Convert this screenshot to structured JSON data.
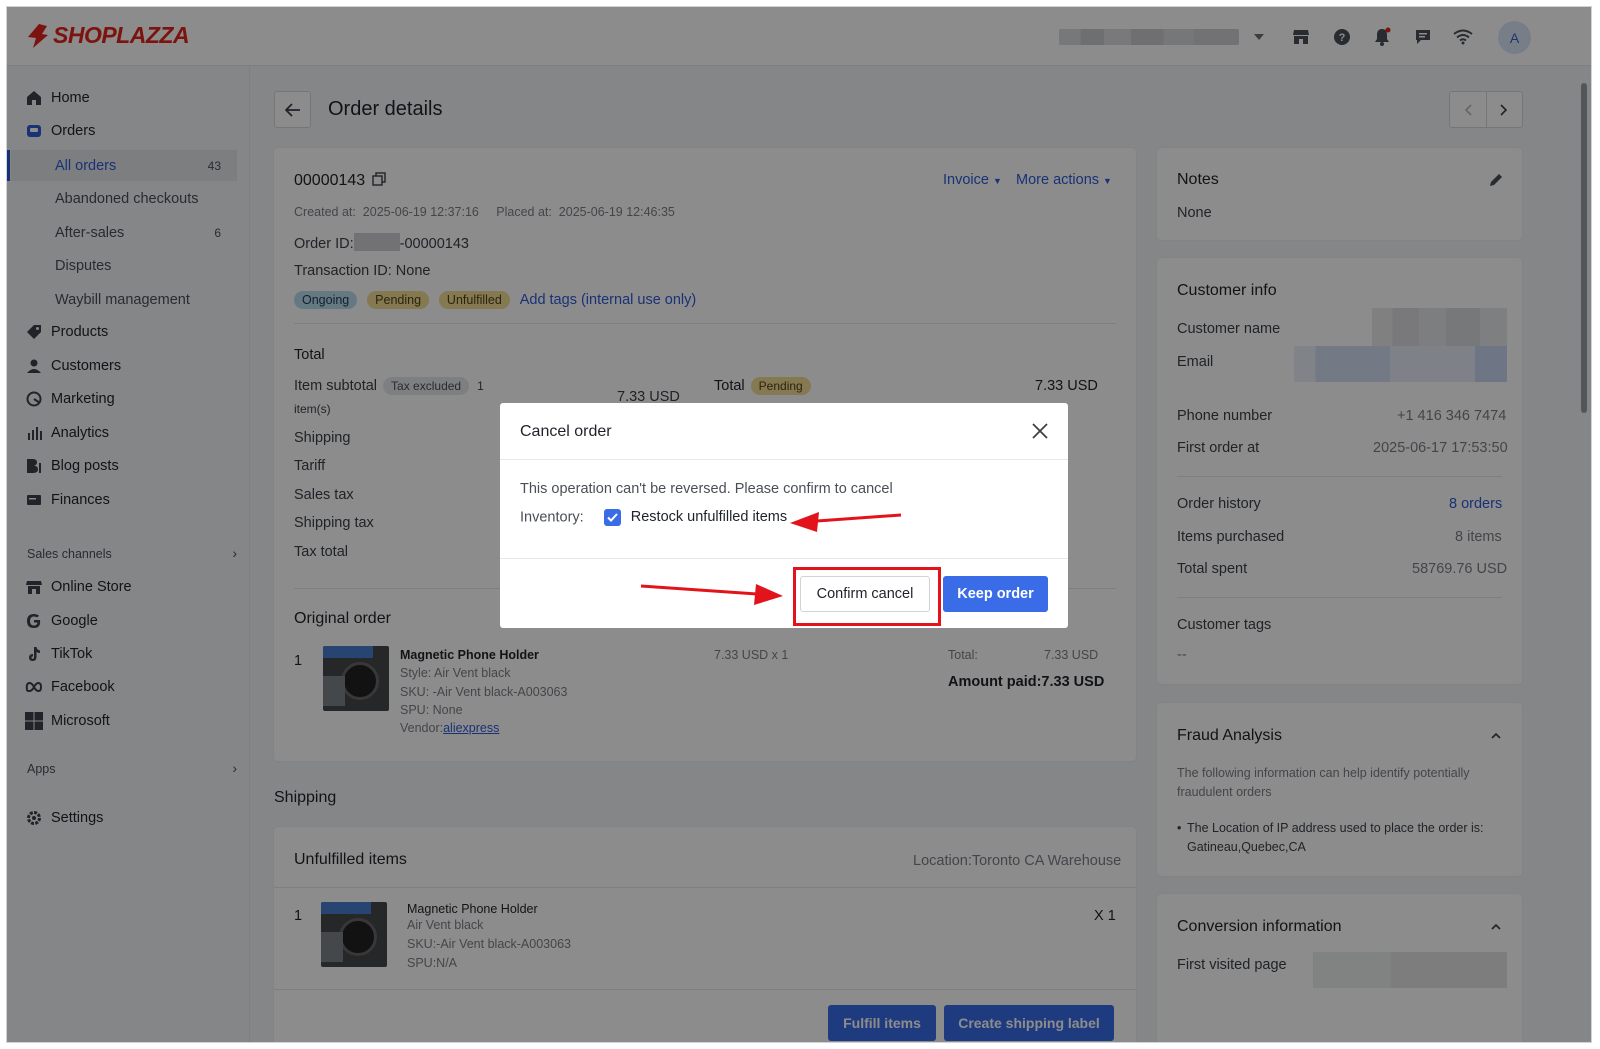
{
  "brand": {
    "name": "SHOPLAZZA",
    "color": "#e2231a"
  },
  "topbar": {
    "avatar_letter": "A",
    "icons": [
      "store-icon",
      "help-icon",
      "bell-icon",
      "chat-icon",
      "wifi-icon"
    ]
  },
  "sidebar": {
    "items": [
      {
        "label": "Home",
        "icon": "home-icon"
      },
      {
        "label": "Orders",
        "icon": "orders-icon"
      },
      {
        "label": "Products",
        "icon": "tag-icon"
      },
      {
        "label": "Customers",
        "icon": "person-icon"
      },
      {
        "label": "Marketing",
        "icon": "marketing-icon"
      },
      {
        "label": "Analytics",
        "icon": "analytics-icon"
      },
      {
        "label": "Blog posts",
        "icon": "blog-icon"
      },
      {
        "label": "Finances",
        "icon": "finances-icon"
      }
    ],
    "orders_sub": [
      {
        "label": "All orders",
        "count": "43"
      },
      {
        "label": "Abandoned checkouts",
        "count": ""
      },
      {
        "label": "After-sales",
        "count": "6"
      },
      {
        "label": "Disputes",
        "count": ""
      },
      {
        "label": "Waybill management",
        "count": ""
      }
    ],
    "sales_channels_label": "Sales channels",
    "channels": [
      {
        "label": "Online Store",
        "icon": "store-icon"
      },
      {
        "label": "Google",
        "icon": "google-icon"
      },
      {
        "label": "TikTok",
        "icon": "tiktok-icon"
      },
      {
        "label": "Facebook",
        "icon": "meta-icon"
      },
      {
        "label": "Microsoft",
        "icon": "microsoft-icon"
      }
    ],
    "apps_label": "Apps",
    "settings_label": "Settings"
  },
  "page": {
    "title": "Order details"
  },
  "order": {
    "number": "00000143",
    "invoice_label": "Invoice",
    "more_actions_label": "More actions",
    "created_label": "Created at:",
    "created_value": "2025-06-19 12:37:16",
    "placed_label": "Placed at:",
    "placed_value": "2025-06-19 12:46:35",
    "order_id_label": "Order ID:",
    "order_id_suffix": "-00000143",
    "transaction_id": "Transaction ID: None",
    "tags": [
      "Ongoing",
      "Pending",
      "Unfulfilled"
    ],
    "add_tags": "Add tags (internal use only)"
  },
  "totals": {
    "heading": "Total",
    "item_subtotal_label": "Item subtotal",
    "tax_excluded": "Tax excluded",
    "item_count": "1",
    "items_suffix": "item(s)",
    "item_subtotal_value": "7.33 USD",
    "rows": [
      "Shipping",
      "Tariff",
      "Sales tax",
      "Shipping tax",
      "Tax total"
    ],
    "total_label": "Total",
    "total_status": "Pending",
    "total_value": "7.33 USD"
  },
  "original_order": {
    "heading": "Original order",
    "index": "1",
    "product_name": "Magnetic Phone Holder",
    "style": "Style: Air Vent black",
    "sku": "SKU: -Air Vent black-A003063",
    "spu": "SPU: None",
    "vendor_label": "Vendor:",
    "vendor": "aliexpress",
    "price_qty": "7.33 USD x 1",
    "total_label": "Total:",
    "total_value": "7.33 USD",
    "amount_paid": "Amount paid:7.33 USD"
  },
  "shipping": {
    "heading": "Shipping",
    "unfulfilled_heading": "Unfulfilled items",
    "location": "Location:Toronto CA Warehouse",
    "index": "1",
    "product_name": "Magnetic Phone Holder",
    "variant": "Air Vent black",
    "sku": "SKU:-Air Vent black-A003063",
    "spu": "SPU:N/A",
    "qty": "X 1",
    "fulfill_btn": "Fulfill items",
    "label_btn": "Create shipping label"
  },
  "notes": {
    "heading": "Notes",
    "value": "None"
  },
  "customer": {
    "heading": "Customer info",
    "name_label": "Customer name",
    "email_label": "Email",
    "phone_label": "Phone number",
    "phone_value": "+1 416 346 7474",
    "first_order_label": "First order at",
    "first_order_value": "2025-06-17 17:53:50",
    "history_label": "Order history",
    "history_value": "8 orders",
    "items_label": "Items purchased",
    "items_value": "8 items",
    "spent_label": "Total spent",
    "spent_value": "58769.76 USD",
    "tags_label": "Customer tags",
    "tags_value": "--"
  },
  "fraud": {
    "heading": "Fraud Analysis",
    "desc": "The following information can help identify potentially fraudulent orders",
    "bullet_line1": "The Location of IP address used to place the order is:",
    "bullet_line2": "Gatineau,Quebec,CA"
  },
  "conversion": {
    "heading": "Conversion information",
    "first_page_label": "First visited page"
  },
  "modal": {
    "title": "Cancel order",
    "message": "This operation can't be reversed. Please confirm to cancel",
    "inventory_label": "Inventory:",
    "restock_label": "Restock unfulfilled items",
    "restock_checked": true,
    "confirm_label": "Confirm cancel",
    "keep_label": "Keep order"
  },
  "colors": {
    "primary": "#3a6ce8",
    "highlight": "#e3131b",
    "link": "#2f5bd8"
  }
}
